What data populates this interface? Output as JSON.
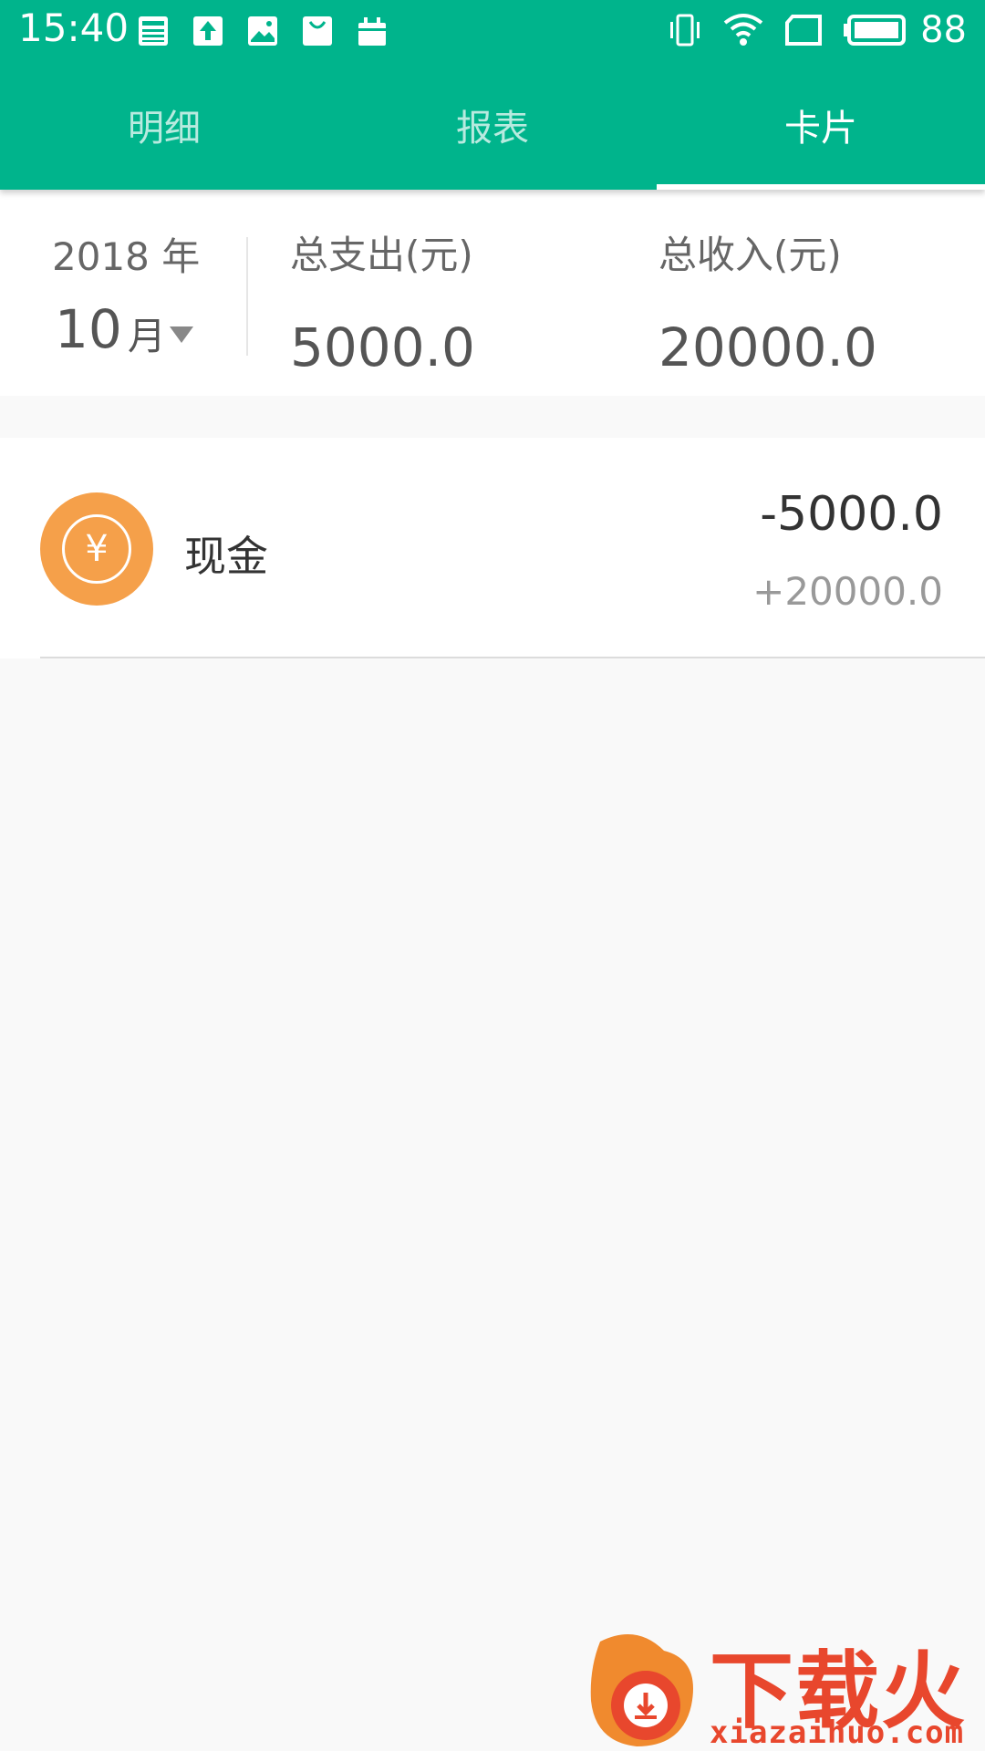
{
  "status_bar": {
    "time": "15:40",
    "battery": "88",
    "notification_icons": [
      "news-icon",
      "upload-icon",
      "image-icon",
      "shopping-bag-icon",
      "calendar-icon"
    ],
    "system_icons": [
      "vibrate-icon",
      "wifi-icon",
      "sim-icon",
      "battery-icon"
    ]
  },
  "tabs": [
    {
      "label": "明细",
      "active": false
    },
    {
      "label": "报表",
      "active": false
    },
    {
      "label": "卡片",
      "active": true
    }
  ],
  "summary": {
    "year": "2018 年",
    "month": "10",
    "month_unit": "月",
    "expense_label": "总支出(元)",
    "expense_value": "5000.0",
    "income_label": "总收入(元)",
    "income_value": "20000.0"
  },
  "cards": [
    {
      "name": "现金",
      "icon": "yuan-icon",
      "icon_glyph": "¥",
      "icon_color": "#f5a04a",
      "expense": "-5000.0",
      "income": "+20000.0"
    }
  ],
  "watermark": {
    "text": "下载火",
    "url": "xiazaihuo.com"
  },
  "colors": {
    "primary": "#00b48c",
    "accent_orange": "#f5a04a",
    "watermark_red": "#e8472d"
  }
}
